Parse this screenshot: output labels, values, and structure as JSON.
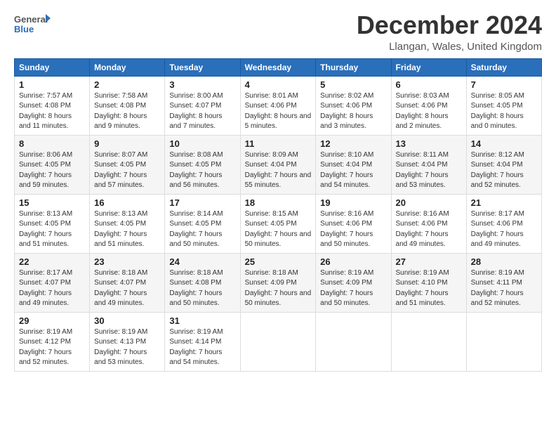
{
  "header": {
    "logo_general": "General",
    "logo_blue": "Blue",
    "month_title": "December 2024",
    "location": "Llangan, Wales, United Kingdom"
  },
  "days_of_week": [
    "Sunday",
    "Monday",
    "Tuesday",
    "Wednesday",
    "Thursday",
    "Friday",
    "Saturday"
  ],
  "weeks": [
    [
      {
        "day": "1",
        "sunrise": "7:57 AM",
        "sunset": "4:08 PM",
        "daylight": "8 hours and 11 minutes."
      },
      {
        "day": "2",
        "sunrise": "7:58 AM",
        "sunset": "4:08 PM",
        "daylight": "8 hours and 9 minutes."
      },
      {
        "day": "3",
        "sunrise": "8:00 AM",
        "sunset": "4:07 PM",
        "daylight": "8 hours and 7 minutes."
      },
      {
        "day": "4",
        "sunrise": "8:01 AM",
        "sunset": "4:06 PM",
        "daylight": "8 hours and 5 minutes."
      },
      {
        "day": "5",
        "sunrise": "8:02 AM",
        "sunset": "4:06 PM",
        "daylight": "8 hours and 3 minutes."
      },
      {
        "day": "6",
        "sunrise": "8:03 AM",
        "sunset": "4:06 PM",
        "daylight": "8 hours and 2 minutes."
      },
      {
        "day": "7",
        "sunrise": "8:05 AM",
        "sunset": "4:05 PM",
        "daylight": "8 hours and 0 minutes."
      }
    ],
    [
      {
        "day": "8",
        "sunrise": "8:06 AM",
        "sunset": "4:05 PM",
        "daylight": "7 hours and 59 minutes."
      },
      {
        "day": "9",
        "sunrise": "8:07 AM",
        "sunset": "4:05 PM",
        "daylight": "7 hours and 57 minutes."
      },
      {
        "day": "10",
        "sunrise": "8:08 AM",
        "sunset": "4:05 PM",
        "daylight": "7 hours and 56 minutes."
      },
      {
        "day": "11",
        "sunrise": "8:09 AM",
        "sunset": "4:04 PM",
        "daylight": "7 hours and 55 minutes."
      },
      {
        "day": "12",
        "sunrise": "8:10 AM",
        "sunset": "4:04 PM",
        "daylight": "7 hours and 54 minutes."
      },
      {
        "day": "13",
        "sunrise": "8:11 AM",
        "sunset": "4:04 PM",
        "daylight": "7 hours and 53 minutes."
      },
      {
        "day": "14",
        "sunrise": "8:12 AM",
        "sunset": "4:04 PM",
        "daylight": "7 hours and 52 minutes."
      }
    ],
    [
      {
        "day": "15",
        "sunrise": "8:13 AM",
        "sunset": "4:05 PM",
        "daylight": "7 hours and 51 minutes."
      },
      {
        "day": "16",
        "sunrise": "8:13 AM",
        "sunset": "4:05 PM",
        "daylight": "7 hours and 51 minutes."
      },
      {
        "day": "17",
        "sunrise": "8:14 AM",
        "sunset": "4:05 PM",
        "daylight": "7 hours and 50 minutes."
      },
      {
        "day": "18",
        "sunrise": "8:15 AM",
        "sunset": "4:05 PM",
        "daylight": "7 hours and 50 minutes."
      },
      {
        "day": "19",
        "sunrise": "8:16 AM",
        "sunset": "4:06 PM",
        "daylight": "7 hours and 50 minutes."
      },
      {
        "day": "20",
        "sunrise": "8:16 AM",
        "sunset": "4:06 PM",
        "daylight": "7 hours and 49 minutes."
      },
      {
        "day": "21",
        "sunrise": "8:17 AM",
        "sunset": "4:06 PM",
        "daylight": "7 hours and 49 minutes."
      }
    ],
    [
      {
        "day": "22",
        "sunrise": "8:17 AM",
        "sunset": "4:07 PM",
        "daylight": "7 hours and 49 minutes."
      },
      {
        "day": "23",
        "sunrise": "8:18 AM",
        "sunset": "4:07 PM",
        "daylight": "7 hours and 49 minutes."
      },
      {
        "day": "24",
        "sunrise": "8:18 AM",
        "sunset": "4:08 PM",
        "daylight": "7 hours and 50 minutes."
      },
      {
        "day": "25",
        "sunrise": "8:18 AM",
        "sunset": "4:09 PM",
        "daylight": "7 hours and 50 minutes."
      },
      {
        "day": "26",
        "sunrise": "8:19 AM",
        "sunset": "4:09 PM",
        "daylight": "7 hours and 50 minutes."
      },
      {
        "day": "27",
        "sunrise": "8:19 AM",
        "sunset": "4:10 PM",
        "daylight": "7 hours and 51 minutes."
      },
      {
        "day": "28",
        "sunrise": "8:19 AM",
        "sunset": "4:11 PM",
        "daylight": "7 hours and 52 minutes."
      }
    ],
    [
      {
        "day": "29",
        "sunrise": "8:19 AM",
        "sunset": "4:12 PM",
        "daylight": "7 hours and 52 minutes."
      },
      {
        "day": "30",
        "sunrise": "8:19 AM",
        "sunset": "4:13 PM",
        "daylight": "7 hours and 53 minutes."
      },
      {
        "day": "31",
        "sunrise": "8:19 AM",
        "sunset": "4:14 PM",
        "daylight": "7 hours and 54 minutes."
      },
      null,
      null,
      null,
      null
    ]
  ]
}
